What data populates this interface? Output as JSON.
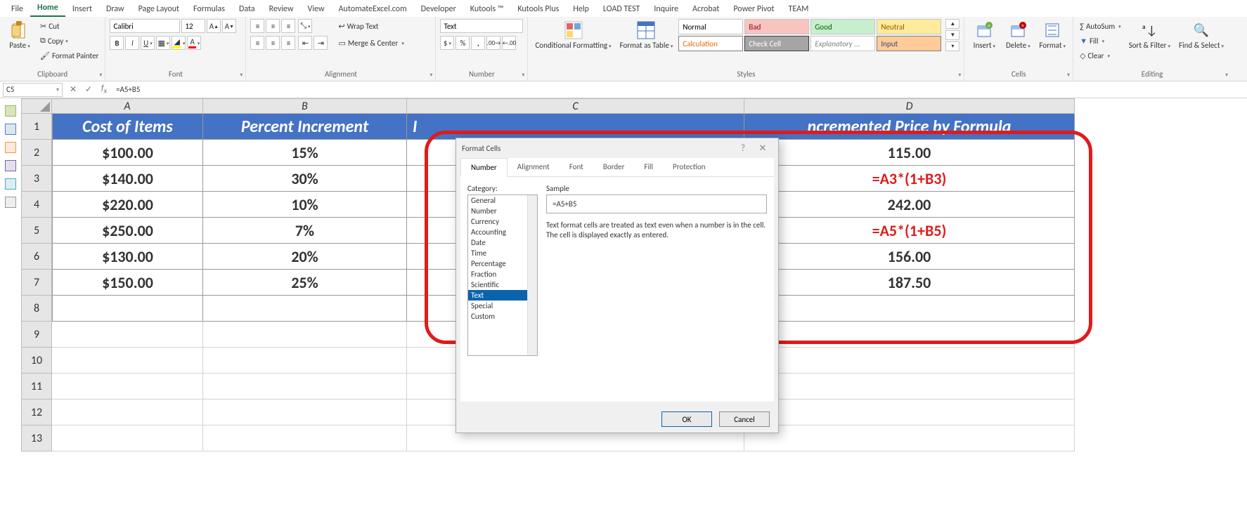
{
  "tabs": [
    "File",
    "Home",
    "Insert",
    "Draw",
    "Page Layout",
    "Formulas",
    "Data",
    "Review",
    "View",
    "AutomateExcel.com",
    "Developer",
    "Kutools ™",
    "Kutools Plus",
    "Help",
    "LOAD TEST",
    "Inquire",
    "Acrobat",
    "Power Pivot",
    "TEAM"
  ],
  "active_tab": "Home",
  "clipboard": {
    "paste": "Paste",
    "cut": "Cut",
    "copy": "Copy",
    "painter": "Format Painter",
    "label": "Clipboard"
  },
  "font": {
    "family": "Calibri",
    "size": "12",
    "label": "Font"
  },
  "alignment": {
    "wrap": "Wrap Text",
    "merge": "Merge & Center",
    "label": "Alignment"
  },
  "number": {
    "format": "Text",
    "label": "Number"
  },
  "styles": {
    "cond": "Conditional Formatting",
    "formatas": "Format as Table",
    "gallery": [
      {
        "t": "Normal",
        "bg": "#ffffff",
        "fg": "#000"
      },
      {
        "t": "Bad",
        "bg": "#f8c4c0",
        "fg": "#9c0006"
      },
      {
        "t": "Good",
        "bg": "#c6efce",
        "fg": "#006100"
      },
      {
        "t": "Neutral",
        "bg": "#ffeb9c",
        "fg": "#9c5700"
      },
      {
        "t": "Calculation",
        "bg": "#fff",
        "fg": "#e26b0a",
        "bd": "#7f7f7f"
      },
      {
        "t": "Check Cell",
        "bg": "#a5a5a5",
        "fg": "#fff",
        "bd": "#3f3f3f"
      },
      {
        "t": "Explanatory ...",
        "bg": "#fff",
        "fg": "#7f7f7f",
        "it": true
      },
      {
        "t": "Input",
        "bg": "#ffcc99",
        "fg": "#3f3f76",
        "bd": "#7f7f7f"
      }
    ],
    "label": "Styles"
  },
  "cells": {
    "insert": "Insert",
    "delete": "Delete",
    "format": "Format",
    "label": "Cells"
  },
  "editing": {
    "autosum": "AutoSum",
    "fill": "Fill",
    "clear": "Clear",
    "sort": "Sort & Filter",
    "find": "Find & Select",
    "label": "Editing"
  },
  "namebox": "C5",
  "formula": "=A5+B5",
  "columns": [
    "A",
    "B",
    "C",
    "D"
  ],
  "sheet": {
    "headers": [
      "Cost of Items",
      "Percent Increment",
      "I",
      "ncremented Price by Formula"
    ],
    "rows": [
      {
        "n": "2",
        "a": "$100.00",
        "b": "15%",
        "d": "115.00",
        "red": false
      },
      {
        "n": "3",
        "a": "$140.00",
        "b": "30%",
        "d": "=A3*(1+B3)",
        "red": true
      },
      {
        "n": "4",
        "a": "$220.00",
        "b": "10%",
        "d": "242.00",
        "red": false
      },
      {
        "n": "5",
        "a": "$250.00",
        "b": "7%",
        "d": "=A5*(1+B5)",
        "red": true
      },
      {
        "n": "6",
        "a": "$130.00",
        "b": "20%",
        "d": "156.00",
        "red": false
      },
      {
        "n": "7",
        "a": "$150.00",
        "b": "25%",
        "d": "187.50",
        "red": false
      }
    ],
    "blank": [
      "8",
      "9",
      "10",
      "11",
      "12",
      "13"
    ]
  },
  "dialog": {
    "title": "Format Cells",
    "tabs": [
      "Number",
      "Alignment",
      "Font",
      "Border",
      "Fill",
      "Protection"
    ],
    "active": "Number",
    "cat_label": "Category:",
    "categories": [
      "General",
      "Number",
      "Currency",
      "Accounting",
      "Date",
      "Time",
      "Percentage",
      "Fraction",
      "Scientific",
      "Text",
      "Special",
      "Custom"
    ],
    "selected": "Text",
    "sample_label": "Sample",
    "sample": "=A5+B5",
    "desc": "Text format cells are treated as text even when a number is in the cell. The cell is displayed exactly as entered.",
    "ok": "OK",
    "cancel": "Cancel"
  }
}
